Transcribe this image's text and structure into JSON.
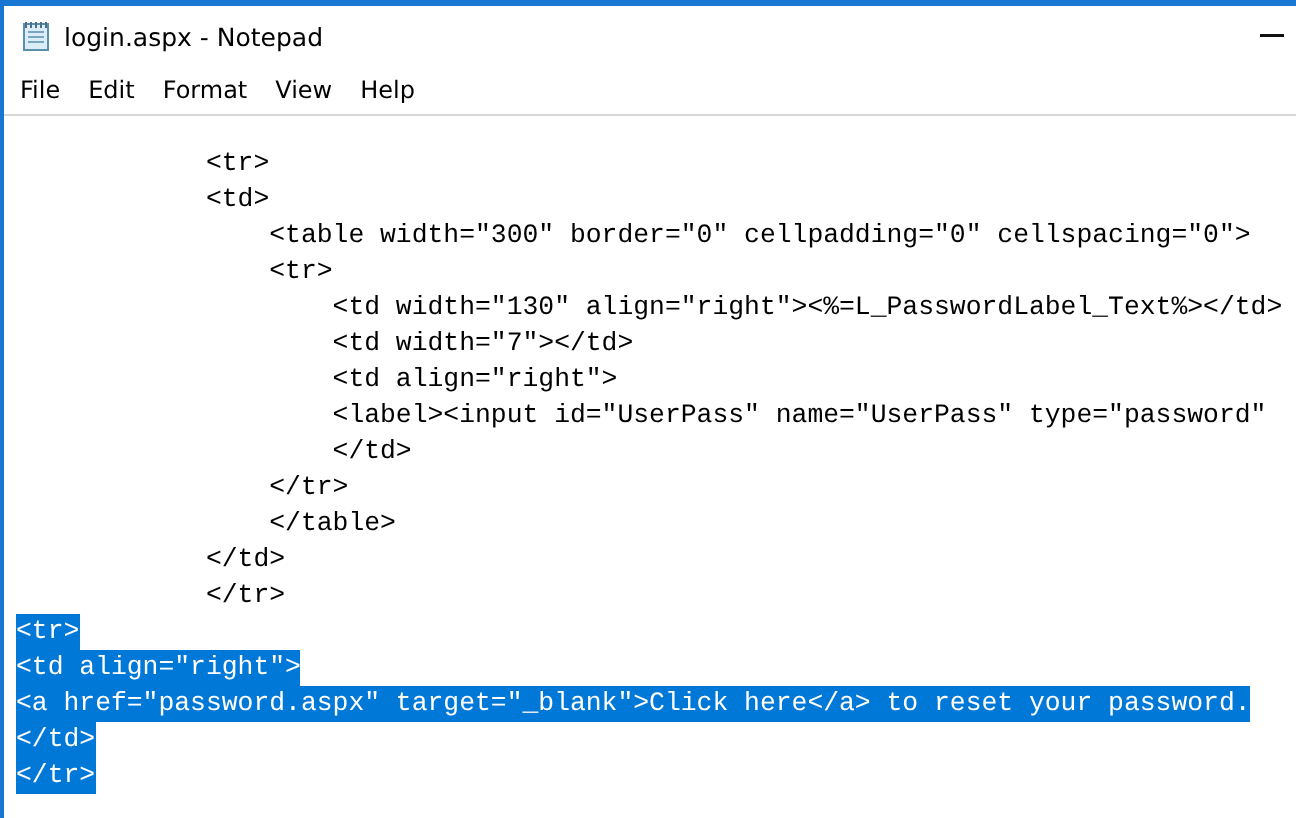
{
  "window": {
    "title": "login.aspx - Notepad"
  },
  "menu": [
    "File",
    "Edit",
    "Format",
    "View",
    "Help"
  ],
  "editor": {
    "lines": [
      {
        "text": "            <tr>",
        "selected": false
      },
      {
        "text": "            <td>",
        "selected": false
      },
      {
        "text": "                <table width=\"300\" border=\"0\" cellpadding=\"0\" cellspacing=\"0\">",
        "selected": false
      },
      {
        "text": "                <tr>",
        "selected": false
      },
      {
        "text": "                    <td width=\"130\" align=\"right\"><%=L_PasswordLabel_Text%></td>",
        "selected": false
      },
      {
        "text": "                    <td width=\"7\"></td>",
        "selected": false
      },
      {
        "text": "                    <td align=\"right\">",
        "selected": false
      },
      {
        "text": "                    <label><input id=\"UserPass\" name=\"UserPass\" type=\"password\"",
        "selected": false
      },
      {
        "text": "                    </td>",
        "selected": false
      },
      {
        "text": "                </tr>",
        "selected": false
      },
      {
        "text": "                </table>",
        "selected": false
      },
      {
        "text": "            </td>",
        "selected": false
      },
      {
        "text": "            </tr>",
        "selected": false
      },
      {
        "text": "<tr>",
        "selected": true
      },
      {
        "text": "<td align=\"right\">",
        "selected": true
      },
      {
        "text": "<a href=\"password.aspx\" target=\"_blank\">Click here</a> to reset your password.",
        "selected": true
      },
      {
        "text": "</td>",
        "selected": true
      },
      {
        "text": "</tr>",
        "selected": true
      }
    ]
  }
}
